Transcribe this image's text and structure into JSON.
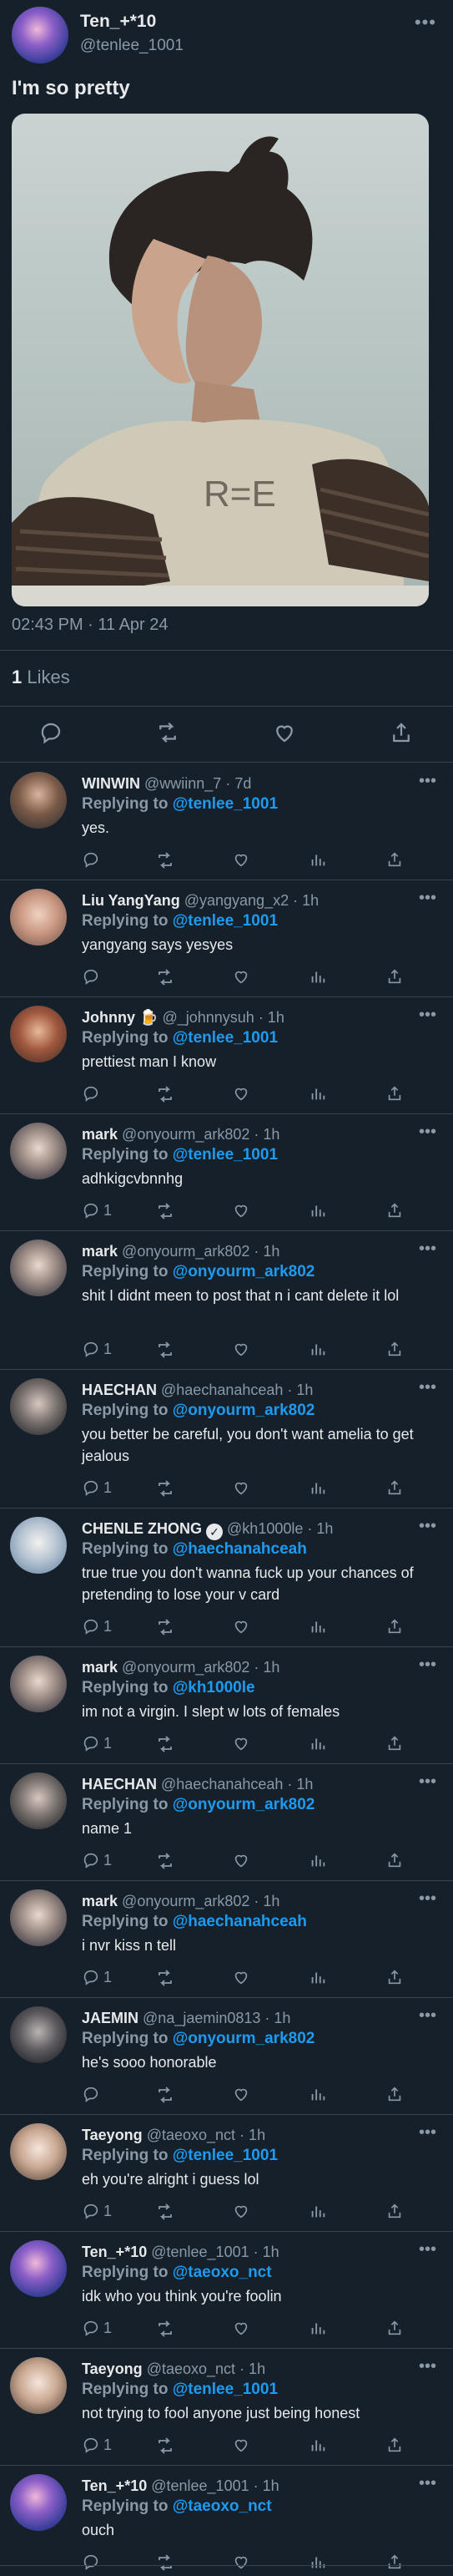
{
  "main_tweet": {
    "display_name": "Ten_+*10",
    "handle": "@tenlee_1001",
    "text": "I'm so pretty",
    "timestamp": "02:43 PM · 11 Apr 24",
    "likes_count": "1",
    "likes_label": "Likes",
    "icons": [
      "reply-icon",
      "retweet-icon",
      "like-icon",
      "share-icon"
    ]
  },
  "replies": [
    {
      "name": "WINWIN",
      "handle": "@wwiinn_7",
      "time": "· 7d",
      "replying_prefix": "Replying to",
      "replying_to": "@tenlee_1001",
      "text": "yes.",
      "reply_count": ""
    },
    {
      "name": "Liu YangYang",
      "handle": "@yangyang_x2",
      "time": "· 1h",
      "replying_prefix": "Replying to",
      "replying_to": "@tenlee_1001",
      "text": "yangyang says yesyes",
      "reply_count": ""
    },
    {
      "name": "Johnny 🍺",
      "handle": "@_johnnysuh",
      "time": "· 1h",
      "replying_prefix": "Replying to",
      "replying_to": "@tenlee_1001",
      "text": "prettiest man I know",
      "reply_count": ""
    },
    {
      "name": "mark",
      "handle": "@onyourm_ark802",
      "time": "· 1h",
      "replying_prefix": "Replying to",
      "replying_to": "@tenlee_1001",
      "text": "adhkigcvbnnhg",
      "reply_count": "1"
    },
    {
      "name": "mark",
      "handle": "@onyourm_ark802",
      "time": "· 1h",
      "replying_prefix": "Replying to",
      "replying_to": "@onyourm_ark802",
      "text": "shit I didnt meen to post that n i cant delete it lol",
      "reply_count": "1"
    },
    {
      "name": "HAECHAN",
      "handle": "@haechanahceah",
      "time": "· 1h",
      "replying_prefix": "Replying to",
      "replying_to": "@onyourm_ark802",
      "text": "you better be careful, you don't want amelia to get jealous",
      "reply_count": "1"
    },
    {
      "name": "CHENLE ZHONG",
      "handle": "@kh1000le",
      "time": "· 1h",
      "replying_prefix": "Replying to",
      "replying_to": "@haechanahceah",
      "text": "true true you don't wanna fuck up your chances of pretending to lose your v card",
      "reply_count": "1",
      "verified": true
    },
    {
      "name": "mark",
      "handle": "@onyourm_ark802",
      "time": "· 1h",
      "replying_prefix": "Replying to",
      "replying_to": "@kh1000le",
      "text": "im not a virgin. I slept w lots of females",
      "reply_count": "1"
    },
    {
      "name": "HAECHAN",
      "handle": "@haechanahceah",
      "time": "· 1h",
      "replying_prefix": "Replying to",
      "replying_to": "@onyourm_ark802",
      "text": "name 1",
      "reply_count": "1"
    },
    {
      "name": "mark",
      "handle": "@onyourm_ark802",
      "time": "· 1h",
      "replying_prefix": "Replying to",
      "replying_to": "@haechanahceah",
      "text": "i nvr kiss n tell",
      "reply_count": "1"
    },
    {
      "name": "JAEMIN",
      "handle": "@na_jaemin0813",
      "time": "· 1h",
      "replying_prefix": "Replying to",
      "replying_to": "@onyourm_ark802",
      "text": "he's sooo honorable",
      "reply_count": ""
    },
    {
      "name": "Taeyong",
      "handle": "@taeoxo_nct",
      "time": "· 1h",
      "replying_prefix": "Replying to",
      "replying_to": "@tenlee_1001",
      "text": "eh you're alright i guess lol",
      "reply_count": "1"
    },
    {
      "name": "Ten_+*10",
      "handle": "@tenlee_1001",
      "time": "· 1h",
      "replying_prefix": "Replying to",
      "replying_to": "@taeoxo_nct",
      "text": "idk who you think you're foolin",
      "reply_count": "1"
    },
    {
      "name": "Taeyong",
      "handle": "@taeoxo_nct",
      "time": "· 1h",
      "replying_prefix": "Replying to",
      "replying_to": "@tenlee_1001",
      "text": "not trying to fool anyone just being honest",
      "reply_count": "1"
    },
    {
      "name": "Ten_+*10",
      "handle": "@tenlee_1001",
      "time": "· 1h",
      "replying_prefix": "Replying to",
      "replying_to": "@taeoxo_nct",
      "text": "ouch",
      "reply_count": ""
    }
  ],
  "colors": {
    "background": "#15202b",
    "link": "#1d9bf0",
    "muted": "#8b98a5",
    "divider": "#38444d"
  }
}
